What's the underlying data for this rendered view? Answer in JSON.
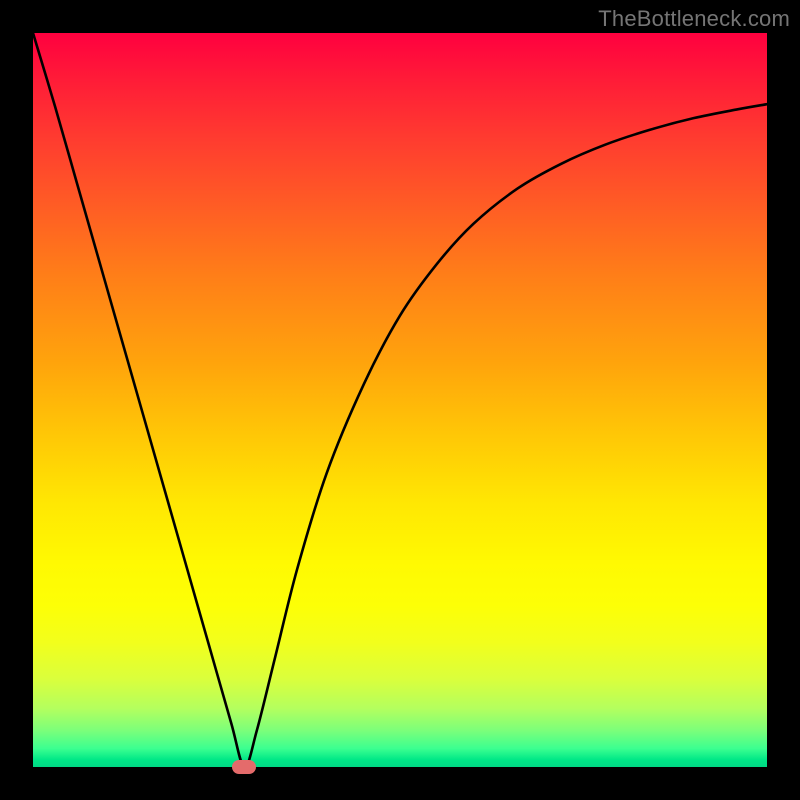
{
  "watermark": "TheBottleneck.com",
  "colors": {
    "page_bg": "#000000",
    "curve_stroke": "#000000",
    "marker_fill": "#e46b6b",
    "watermark_text": "#757575"
  },
  "chart_data": {
    "type": "line",
    "title": "",
    "xlabel": "",
    "ylabel": "",
    "xlim": [
      0,
      100
    ],
    "ylim": [
      0,
      100
    ],
    "grid": false,
    "legend": false,
    "series": [
      {
        "name": "bottleneck-curve",
        "x": [
          0,
          3,
          6,
          9,
          12,
          15,
          18,
          21,
          24,
          27,
          28.8,
          30.5,
          33,
          36,
          40,
          45,
          50,
          55,
          60,
          66,
          72,
          78,
          84,
          90,
          96,
          100
        ],
        "y": [
          100,
          90,
          79.5,
          69,
          58.5,
          48,
          37.5,
          27,
          16.5,
          6,
          0,
          5,
          15,
          27,
          40,
          52,
          61.5,
          68.5,
          74,
          78.8,
          82.2,
          84.8,
          86.8,
          88.4,
          89.6,
          90.3
        ]
      }
    ],
    "annotations": [
      {
        "name": "sweet-spot-marker",
        "x": 28.8,
        "y": 0
      }
    ],
    "background_gradient": {
      "direction": "vertical",
      "stops": [
        {
          "pos": 0.0,
          "color": "#ff003f"
        },
        {
          "pos": 0.5,
          "color": "#ffc806"
        },
        {
          "pos": 0.78,
          "color": "#fdff06"
        },
        {
          "pos": 1.0,
          "color": "#00d985"
        }
      ]
    }
  }
}
